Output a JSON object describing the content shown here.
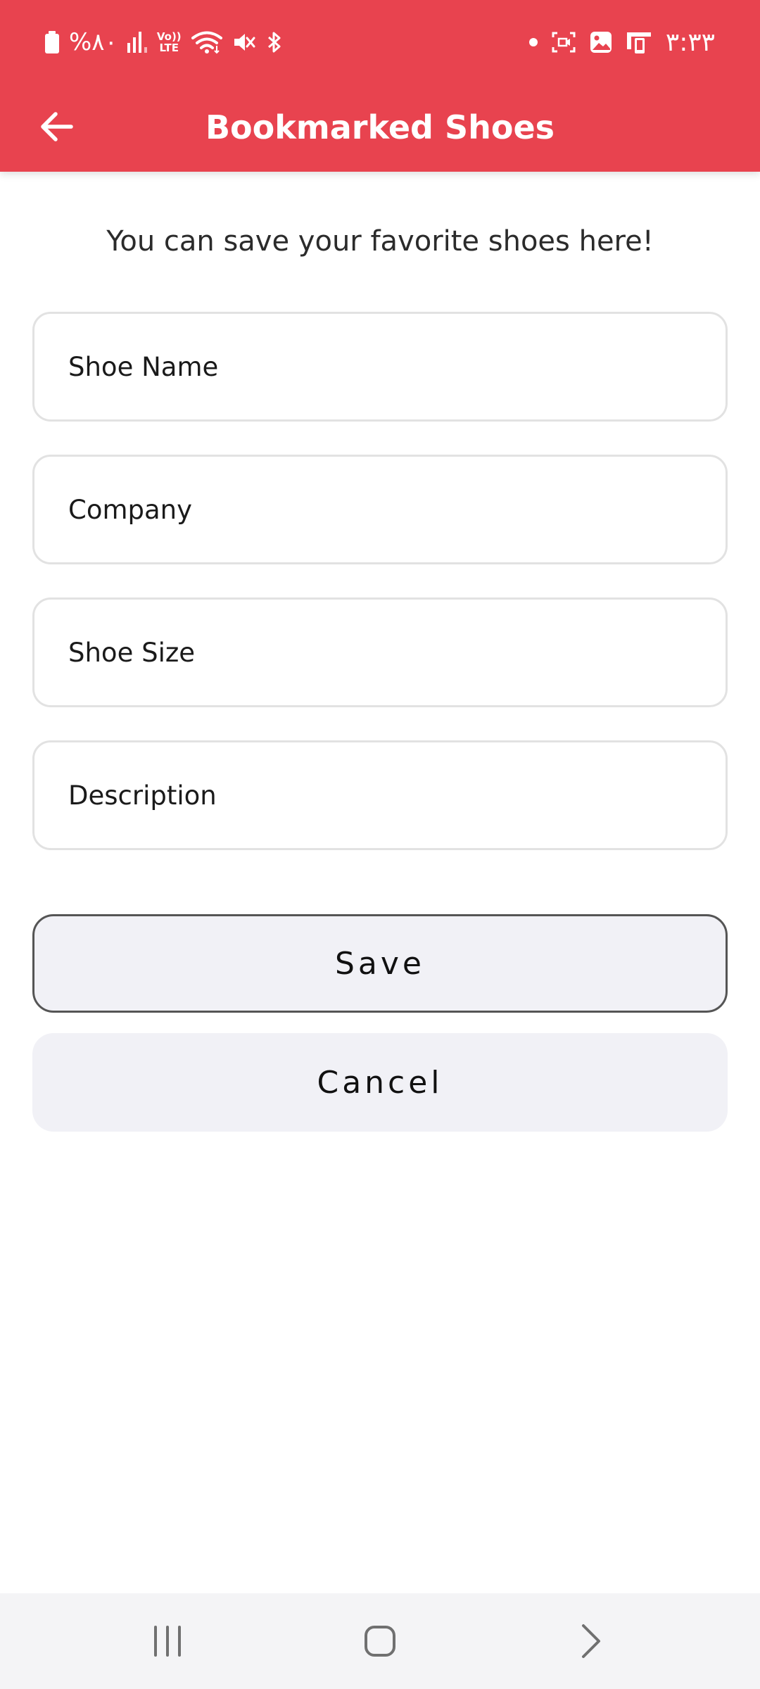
{
  "status_bar": {
    "battery_text": "%۸۰",
    "volte_top": "Vo))",
    "volte_bottom": "LTE",
    "time": "۳:۳۳"
  },
  "header": {
    "title": "Bookmarked Shoes",
    "background_color": "#e8434f"
  },
  "main": {
    "subtitle": "You can save your favorite shoes here!",
    "fields": {
      "shoe_name": {
        "placeholder": "Shoe Name",
        "value": ""
      },
      "company": {
        "placeholder": "Company",
        "value": ""
      },
      "shoe_size": {
        "placeholder": "Shoe Size",
        "value": ""
      },
      "description": {
        "placeholder": "Description",
        "value": ""
      }
    },
    "save_label": "Save",
    "cancel_label": "Cancel"
  },
  "icons": {
    "back": "arrow-left-icon",
    "nav_recents": "recents-icon",
    "nav_home": "home-icon",
    "nav_back": "chevron-right-icon"
  }
}
